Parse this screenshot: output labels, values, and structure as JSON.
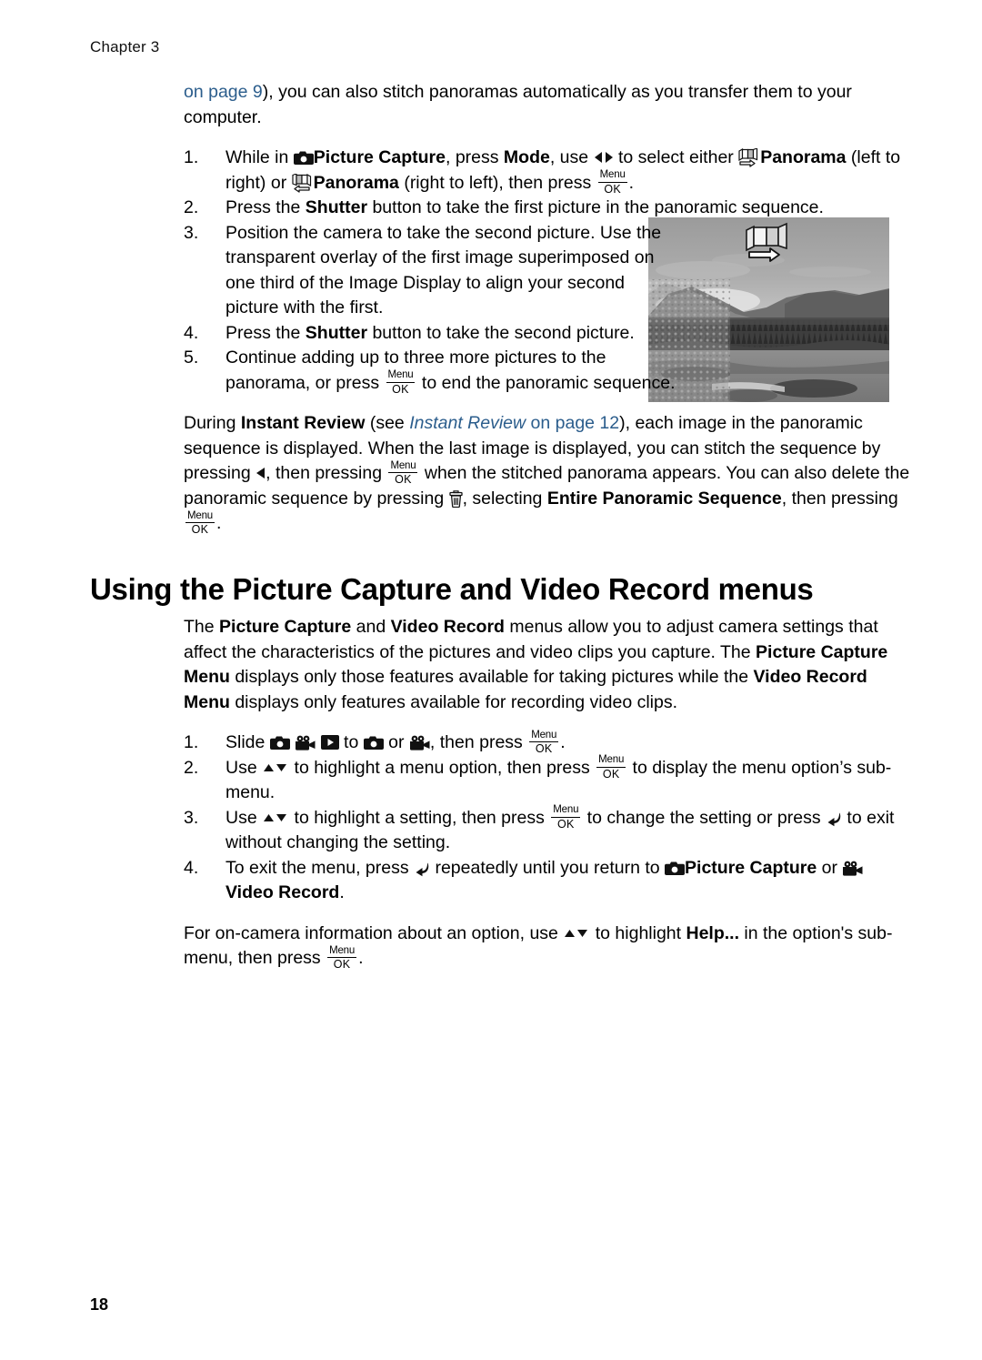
{
  "document": {
    "chapter_label": "Chapter 3",
    "page_number": "18"
  },
  "intro": {
    "link_text": "on page 9",
    "rest": "), you can also stitch panoramas automatically as you transfer them to your computer."
  },
  "panorama_steps": [
    {
      "number": "1.",
      "segments": {
        "p1": "While in ",
        "b1": "Picture Capture",
        "p2": ", press ",
        "b2": "Mode",
        "p3": ", use ",
        "p4": " to select either ",
        "b3": "Panorama",
        "p5": " (left to right) or ",
        "b4": "Panorama",
        "p6": " (right to left), then press ",
        "p7": "."
      }
    },
    {
      "number": "2.",
      "segments": {
        "p1": "Press the ",
        "b1": "Shutter",
        "p2": " button to take the first picture in the panoramic sequence."
      }
    },
    {
      "number": "3.",
      "segments": {
        "p1": "Position the camera to take the second picture. Use the transparent overlay of the first image superimposed on one third of the Image Display to align your second picture with the first."
      }
    },
    {
      "number": "4.",
      "segments": {
        "p1": "Press the ",
        "b1": "Shutter",
        "p2": " button to take the second picture."
      }
    },
    {
      "number": "5.",
      "segments": {
        "p1": "Continue adding up to three more pictures to the panorama, or press ",
        "p2": " to end the panoramic sequence."
      }
    }
  ],
  "instant_review_paragraph": {
    "p1": "During ",
    "b1": "Instant Review",
    "p2": " (see ",
    "link_italic": "Instant Review",
    "link_rest": " on page 12",
    "p3": "), each image in the panoramic sequence is displayed. When the last image is displayed, you can stitch the sequence by pressing ",
    "p4": ", then pressing ",
    "p5": " when the stitched panorama appears. You can also delete the panoramic sequence by pressing ",
    "p6": ", selecting ",
    "b2": "Entire Panoramic Sequence",
    "p7": ", then pressing ",
    "p8": "."
  },
  "section": {
    "heading": "Using the Picture Capture and Video Record menus",
    "intro": {
      "p1": "The ",
      "b1": "Picture Capture",
      "p2": " and ",
      "b2": "Video Record",
      "p3": " menus allow you to adjust camera settings that affect the characteristics of the pictures and video clips you capture. The ",
      "b3": "Picture Capture Menu",
      "p4": " displays only those features available for taking pictures while the ",
      "b4": "Video Record Menu",
      "p5": " displays only features available for recording video clips."
    }
  },
  "menu_steps": [
    {
      "number": "1.",
      "segments": {
        "p1": "Slide ",
        "p2": " to ",
        "p3": " or ",
        "p4": ", then press ",
        "p5": "."
      }
    },
    {
      "number": "2.",
      "segments": {
        "p1": "Use ",
        "p2": " to highlight a menu option, then press ",
        "p3": " to display the menu option’s sub-menu."
      }
    },
    {
      "number": "3.",
      "segments": {
        "p1": "Use ",
        "p2": " to highlight a setting, then press ",
        "p3": " to change the setting or press ",
        "p4": " to exit without changing the setting."
      }
    },
    {
      "number": "4.",
      "segments": {
        "p1": "To exit the menu, press ",
        "p2": " repeatedly until you return to ",
        "b1": "Picture Capture",
        "p3": " or ",
        "b2": "Video Record",
        "p4": "."
      }
    }
  ],
  "help_paragraph": {
    "p1": "For on-camera information about an option, use ",
    "p2": " to highlight ",
    "b1": "Help...",
    "p3": " in the option's sub-menu, then press ",
    "p4": "."
  },
  "icons": {
    "camera": "camera-icon",
    "video": "video-camera-icon",
    "playback": "playback-icon",
    "panorama_left_to_right": "panorama-left-to-right-icon",
    "panorama_right_to_left": "panorama-right-to-left-icon",
    "trash": "trash-icon",
    "back": "back-arrow-icon",
    "left_right_arrows": "left-right-arrows-icon",
    "left_arrow": "left-arrow-icon",
    "up_down_arrows": "up-down-arrows-icon",
    "menu_ok_top": "Menu",
    "menu_ok_bottom": "OK"
  },
  "figure": {
    "alt": "Grayscale photo of a mountain meadow with a panorama overlay icon",
    "overlay_icon": "panorama-left-to-right-overlay"
  },
  "colors": {
    "text": "#000000",
    "link": "#2b5d8c",
    "page_background": "#ffffff"
  }
}
